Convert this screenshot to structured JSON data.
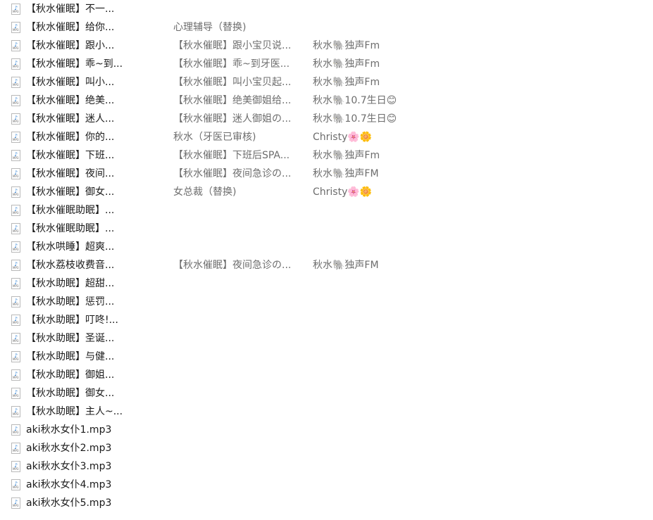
{
  "file_type_icon": "mp3-file-icon",
  "rows": [
    {
      "name": "【秋水催眠】不一...",
      "title": "",
      "artist": ""
    },
    {
      "name": "【秋水催眠】给你...",
      "title": "心理辅导（替换)",
      "artist": ""
    },
    {
      "name": "【秋水催眠】跟小...",
      "title": "【秋水催眠】跟小宝贝说...",
      "artist": "秋水🐘独声Fm"
    },
    {
      "name": "【秋水催眠】乖~到...",
      "title": "【秋水催眠】乖~到牙医...",
      "artist": "秋水🐘独声Fm"
    },
    {
      "name": "【秋水催眠】叫小...",
      "title": "【秋水催眠】叫小宝贝起...",
      "artist": "秋水🐘独声Fm"
    },
    {
      "name": "【秋水催眠】绝美...",
      "title": "【秋水催眠】绝美御姐给...",
      "artist": "秋水🐘10.7生日😊"
    },
    {
      "name": "【秋水催眠】迷人...",
      "title": "【秋水催眠】迷人御姐の...",
      "artist": "秋水🐘10.7生日😊"
    },
    {
      "name": "【秋水催眠】你的...",
      "title": "秋水（牙医已审核)",
      "artist": "Christy🌸🌼"
    },
    {
      "name": "【秋水催眠】下班...",
      "title": "【秋水催眠】下班后SPA...",
      "artist": "秋水🐘独声Fm"
    },
    {
      "name": "【秋水催眠】夜间...",
      "title": "【秋水催眠】夜间急诊の...",
      "artist": "秋水🐘独声FM"
    },
    {
      "name": "【秋水催眠】御女...",
      "title": "女总裁（替换)",
      "artist": "Christy🌸🌼"
    },
    {
      "name": "【秋水催眠助眠】...",
      "title": "",
      "artist": ""
    },
    {
      "name": "【秋水催眠助眠】...",
      "title": "",
      "artist": ""
    },
    {
      "name": "【秋水哄睡】超爽...",
      "title": "",
      "artist": ""
    },
    {
      "name": "【秋水荔枝收费音...",
      "title": "【秋水催眠】夜间急诊の...",
      "artist": "秋水🐘独声FM"
    },
    {
      "name": "【秋水助眠】超甜...",
      "title": "",
      "artist": ""
    },
    {
      "name": "【秋水助眠】惩罚...",
      "title": "",
      "artist": ""
    },
    {
      "name": "【秋水助眠】叮咚!...",
      "title": "",
      "artist": ""
    },
    {
      "name": "【秋水助眠】圣诞...",
      "title": "",
      "artist": ""
    },
    {
      "name": "【秋水助眠】与健...",
      "title": "",
      "artist": ""
    },
    {
      "name": "【秋水助眠】御姐...",
      "title": "",
      "artist": ""
    },
    {
      "name": "【秋水助眠】御女...",
      "title": "",
      "artist": ""
    },
    {
      "name": "【秋水助眠】主人~...",
      "title": "",
      "artist": ""
    },
    {
      "name": "aki秋水女仆1.mp3",
      "title": "",
      "artist": ""
    },
    {
      "name": "aki秋水女仆2.mp3",
      "title": "",
      "artist": ""
    },
    {
      "name": "aki秋水女仆3.mp3",
      "title": "",
      "artist": ""
    },
    {
      "name": "aki秋水女仆4.mp3",
      "title": "",
      "artist": ""
    },
    {
      "name": "aki秋水女仆5.mp3",
      "title": "",
      "artist": ""
    }
  ]
}
